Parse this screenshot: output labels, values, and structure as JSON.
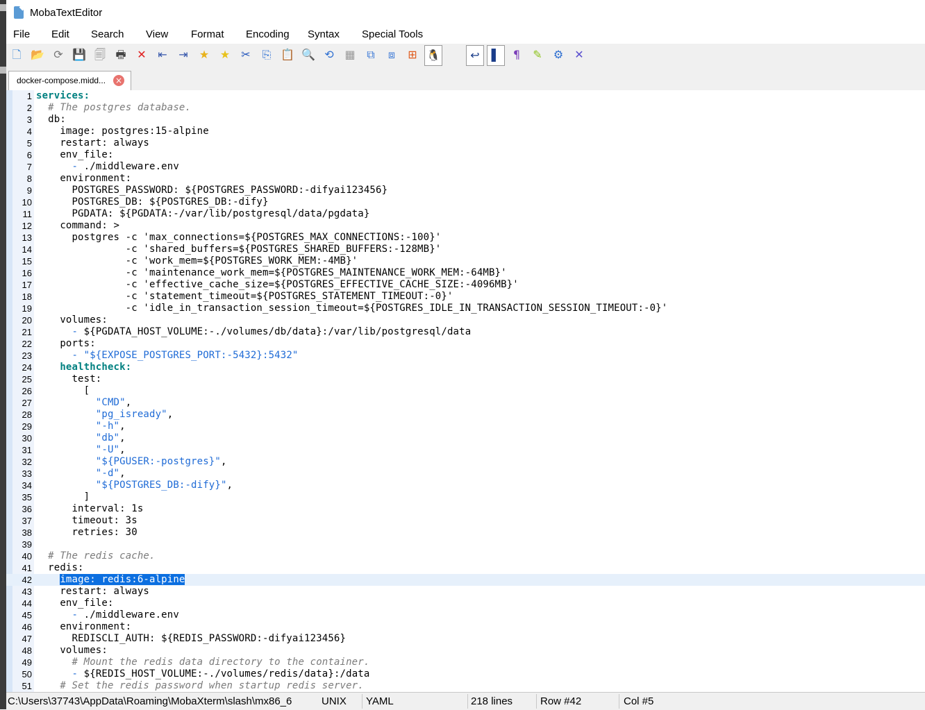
{
  "window": {
    "title": "MobaTextEditor"
  },
  "menu": [
    "File",
    "Edit",
    "Search",
    "View",
    "Format",
    "Encoding",
    "Syntax",
    "Special Tools"
  ],
  "toolbar": [
    {
      "name": "new-file-icon",
      "glyph": "🗋",
      "color": "#4a90d9"
    },
    {
      "name": "open-folder-icon",
      "glyph": "📂",
      "color": "#e0a21b"
    },
    {
      "name": "reload-icon",
      "glyph": "⟳",
      "color": "#777777"
    },
    {
      "name": "save-icon",
      "glyph": "💾",
      "color": "#888888"
    },
    {
      "name": "save-all-icon",
      "glyph": "🗐",
      "color": "#888888"
    },
    {
      "name": "print-icon",
      "glyph": "🖶",
      "color": "#444444"
    },
    {
      "name": "close-file-icon",
      "glyph": "✕",
      "color": "#e02020"
    },
    {
      "name": "unindent-icon",
      "glyph": "⇤",
      "color": "#3355aa"
    },
    {
      "name": "indent-icon",
      "glyph": "⇥",
      "color": "#3355aa"
    },
    {
      "name": "bookmark-add-icon",
      "glyph": "★",
      "color": "#e8b21b"
    },
    {
      "name": "bookmark-next-icon",
      "glyph": "★",
      "color": "#e8c21b"
    },
    {
      "name": "cut-icon",
      "glyph": "✂",
      "color": "#2255bb"
    },
    {
      "name": "copy-icon",
      "glyph": "⎘",
      "color": "#3a78d6"
    },
    {
      "name": "paste-icon",
      "glyph": "📋",
      "color": "#999999"
    },
    {
      "name": "search-icon",
      "glyph": "🔍",
      "color": "#2e6fd1"
    },
    {
      "name": "replace-icon",
      "glyph": "⟲",
      "color": "#2e6fd1"
    },
    {
      "name": "goto-icon",
      "glyph": "▦",
      "color": "#999999"
    },
    {
      "name": "compare-icon",
      "glyph": "⧉",
      "color": "#3a78d6"
    },
    {
      "name": "merge-icon",
      "glyph": "⧈",
      "color": "#3a78d6"
    },
    {
      "name": "windows-format-icon",
      "glyph": "⊞",
      "color": "#e05a1b"
    },
    {
      "name": "linux-format-icon",
      "glyph": "🐧",
      "color": "#222222"
    },
    {
      "name": "mac-format-icon",
      "glyph": "",
      "color": "#3a78d6"
    },
    {
      "name": "word-wrap-icon",
      "glyph": "↩",
      "color": "#1a3d8a"
    },
    {
      "name": "column-mode-icon",
      "glyph": "▌",
      "color": "#1a3d8a"
    },
    {
      "name": "show-symbols-icon",
      "glyph": "¶",
      "color": "#7a3db8"
    },
    {
      "name": "highlight-icon",
      "glyph": "✎",
      "color": "#8cc21b"
    },
    {
      "name": "settings-icon",
      "glyph": "⚙",
      "color": "#2e6fd1"
    },
    {
      "name": "exit-icon",
      "glyph": "✕",
      "color": "#5a4fcf"
    }
  ],
  "tab": {
    "label": "docker-compose.midd..."
  },
  "editor": {
    "current_line": 42,
    "lines": [
      {
        "n": "1",
        "parts": [
          [
            "k",
            "services:"
          ]
        ]
      },
      {
        "n": "2",
        "parts": [
          [
            "p",
            "  "
          ],
          [
            "c",
            "# The postgres database."
          ]
        ]
      },
      {
        "n": "3",
        "parts": [
          [
            "p",
            "  db:"
          ]
        ]
      },
      {
        "n": "4",
        "parts": [
          [
            "p",
            "    image: postgres:15-alpine"
          ]
        ]
      },
      {
        "n": "5",
        "parts": [
          [
            "p",
            "    restart: always"
          ]
        ]
      },
      {
        "n": "6",
        "parts": [
          [
            "p",
            "    env_file:"
          ]
        ]
      },
      {
        "n": "7",
        "parts": [
          [
            "p",
            "      "
          ],
          [
            "s",
            "-"
          ],
          [
            "p",
            " ./middleware.env"
          ]
        ]
      },
      {
        "n": "8",
        "parts": [
          [
            "p",
            "    environment:"
          ]
        ]
      },
      {
        "n": "9",
        "parts": [
          [
            "p",
            "      POSTGRES_PASSWORD: ${POSTGRES_PASSWORD:-difyai123456}"
          ]
        ]
      },
      {
        "n": "10",
        "parts": [
          [
            "p",
            "      POSTGRES_DB: ${POSTGRES_DB:-dify}"
          ]
        ]
      },
      {
        "n": "11",
        "parts": [
          [
            "p",
            "      PGDATA: ${PGDATA:-/var/lib/postgresql/data/pgdata}"
          ]
        ]
      },
      {
        "n": "12",
        "parts": [
          [
            "p",
            "    command: >"
          ]
        ]
      },
      {
        "n": "13",
        "parts": [
          [
            "p",
            "      postgres -c 'max_connections=${POSTGRES_MAX_CONNECTIONS:-100}'"
          ]
        ]
      },
      {
        "n": "14",
        "parts": [
          [
            "p",
            "               -c 'shared_buffers=${POSTGRES_SHARED_BUFFERS:-128MB}'"
          ]
        ]
      },
      {
        "n": "15",
        "parts": [
          [
            "p",
            "               -c 'work_mem=${POSTGRES_WORK_MEM:-4MB}'"
          ]
        ]
      },
      {
        "n": "16",
        "parts": [
          [
            "p",
            "               -c 'maintenance_work_mem=${POSTGRES_MAINTENANCE_WORK_MEM:-64MB}'"
          ]
        ]
      },
      {
        "n": "17",
        "parts": [
          [
            "p",
            "               -c 'effective_cache_size=${POSTGRES_EFFECTIVE_CACHE_SIZE:-4096MB}'"
          ]
        ]
      },
      {
        "n": "18",
        "parts": [
          [
            "p",
            "               -c 'statement_timeout=${POSTGRES_STATEMENT_TIMEOUT:-0}'"
          ]
        ]
      },
      {
        "n": "19",
        "parts": [
          [
            "p",
            "               -c 'idle_in_transaction_session_timeout=${POSTGRES_IDLE_IN_TRANSACTION_SESSION_TIMEOUT:-0}'"
          ]
        ]
      },
      {
        "n": "20",
        "parts": [
          [
            "p",
            "    volumes:"
          ]
        ]
      },
      {
        "n": "21",
        "parts": [
          [
            "p",
            "      "
          ],
          [
            "s",
            "-"
          ],
          [
            "p",
            " ${PGDATA_HOST_VOLUME:-./volumes/db/data}:/var/lib/postgresql/data"
          ]
        ]
      },
      {
        "n": "22",
        "parts": [
          [
            "p",
            "    ports:"
          ]
        ]
      },
      {
        "n": "23",
        "parts": [
          [
            "p",
            "      "
          ],
          [
            "s",
            "- \"${EXPOSE_POSTGRES_PORT:-5432}:5432\""
          ]
        ]
      },
      {
        "n": "24",
        "parts": [
          [
            "p",
            "    "
          ],
          [
            "k",
            "healthcheck:"
          ]
        ]
      },
      {
        "n": "25",
        "parts": [
          [
            "p",
            "      test:"
          ]
        ]
      },
      {
        "n": "26",
        "parts": [
          [
            "p",
            "        ["
          ]
        ]
      },
      {
        "n": "27",
        "parts": [
          [
            "p",
            "          "
          ],
          [
            "s",
            "\"CMD\""
          ],
          [
            "p",
            ","
          ]
        ]
      },
      {
        "n": "28",
        "parts": [
          [
            "p",
            "          "
          ],
          [
            "s",
            "\"pg_isready\""
          ],
          [
            "p",
            ","
          ]
        ]
      },
      {
        "n": "29",
        "parts": [
          [
            "p",
            "          "
          ],
          [
            "s",
            "\"-h\""
          ],
          [
            "p",
            ","
          ]
        ]
      },
      {
        "n": "30",
        "parts": [
          [
            "p",
            "          "
          ],
          [
            "s",
            "\"db\""
          ],
          [
            "p",
            ","
          ]
        ]
      },
      {
        "n": "31",
        "parts": [
          [
            "p",
            "          "
          ],
          [
            "s",
            "\"-U\""
          ],
          [
            "p",
            ","
          ]
        ]
      },
      {
        "n": "32",
        "parts": [
          [
            "p",
            "          "
          ],
          [
            "s",
            "\"${PGUSER:-postgres}\""
          ],
          [
            "p",
            ","
          ]
        ]
      },
      {
        "n": "33",
        "parts": [
          [
            "p",
            "          "
          ],
          [
            "s",
            "\"-d\""
          ],
          [
            "p",
            ","
          ]
        ]
      },
      {
        "n": "34",
        "parts": [
          [
            "p",
            "          "
          ],
          [
            "s",
            "\"${POSTGRES_DB:-dify}\""
          ],
          [
            "p",
            ","
          ]
        ]
      },
      {
        "n": "35",
        "parts": [
          [
            "p",
            "        ]"
          ]
        ]
      },
      {
        "n": "36",
        "parts": [
          [
            "p",
            "      interval: 1s"
          ]
        ]
      },
      {
        "n": "37",
        "parts": [
          [
            "p",
            "      timeout: 3s"
          ]
        ]
      },
      {
        "n": "38",
        "parts": [
          [
            "p",
            "      retries: 30"
          ]
        ]
      },
      {
        "n": "39",
        "parts": [
          [
            "p",
            ""
          ]
        ]
      },
      {
        "n": "40",
        "parts": [
          [
            "p",
            "  "
          ],
          [
            "c",
            "# The redis cache."
          ]
        ]
      },
      {
        "n": "41",
        "parts": [
          [
            "p",
            "  redis:"
          ]
        ]
      },
      {
        "n": "42",
        "parts": [
          [
            "p",
            "    "
          ],
          [
            "sel",
            "image: redis:6-alpine"
          ]
        ]
      },
      {
        "n": "43",
        "parts": [
          [
            "p",
            "    restart: always"
          ]
        ]
      },
      {
        "n": "44",
        "parts": [
          [
            "p",
            "    env_file:"
          ]
        ]
      },
      {
        "n": "45",
        "parts": [
          [
            "p",
            "      "
          ],
          [
            "s",
            "-"
          ],
          [
            "p",
            " ./middleware.env"
          ]
        ]
      },
      {
        "n": "46",
        "parts": [
          [
            "p",
            "    environment:"
          ]
        ]
      },
      {
        "n": "47",
        "parts": [
          [
            "p",
            "      REDISCLI_AUTH: ${REDIS_PASSWORD:-difyai123456}"
          ]
        ]
      },
      {
        "n": "48",
        "parts": [
          [
            "p",
            "    volumes:"
          ]
        ]
      },
      {
        "n": "49",
        "parts": [
          [
            "p",
            "      "
          ],
          [
            "c",
            "# Mount the redis data directory to the container."
          ]
        ]
      },
      {
        "n": "50",
        "parts": [
          [
            "p",
            "      "
          ],
          [
            "s",
            "-"
          ],
          [
            "p",
            " ${REDIS_HOST_VOLUME:-./volumes/redis/data}:/data"
          ]
        ]
      },
      {
        "n": "51",
        "parts": [
          [
            "p",
            "    "
          ],
          [
            "c",
            "# Set the redis password when startup redis server."
          ]
        ]
      }
    ]
  },
  "status": {
    "path": "C:\\Users\\37743\\AppData\\Roaming\\MobaXterm\\slash\\mx86_6",
    "line_ending": "UNIX",
    "syntax": "YAML",
    "total_lines": "218 lines",
    "row": "Row #42",
    "col": "Col #5"
  }
}
